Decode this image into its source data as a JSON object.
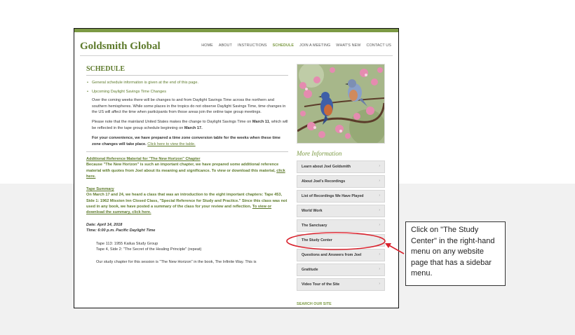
{
  "site": {
    "logo": "Goldsmith Global"
  },
  "nav": [
    "HOME",
    "ABOUT",
    "INSTRUCTIONS",
    "SCHEDULE",
    "JOIN A MEETING",
    "WHAT'S NEW",
    "CONTACT US"
  ],
  "nav_active": "SCHEDULE",
  "main": {
    "title": "SCHEDULE",
    "bullet1": "General schedule information is given at the end of this page.",
    "bullet2": "Upcoming Daylight Savings Time Changes",
    "p1": "Over the coming weeks there will be changes to and from Daylight Savings Time across the northern and southern hemispheres.  While some places in the tropics do not observe Daylight Savings Time, time changes in the US will affect the time when participants from those areas join the online tape group meetings.",
    "p2_a": "Please note that the mainland United States makes the change to Daylight Savings Time on ",
    "p2_b": "March 11",
    "p2_c": ", which will be reflected in the tape group schedule beginning on ",
    "p2_d": "March 17.",
    "p3_a": "For your convenience, we have prepared a time zone conversion table for the weeks when these time zone changes will take place.  ",
    "p3_link": "Click here to view the table.",
    "ref_heading": "Additional Reference Material for \"The New Horizon\" Chapter",
    "ref_text": "Because \"The New Horizon\" is such an important chapter, we have prepared some additional reference material with quotes from Joel about its meaning and significance.  To view or download this material, ",
    "ref_link": "click here.",
    "tape_heading": "Tape Summary",
    "tape_text": "On March 17 and 24, we heard a class that was an introduction to the eight important chapters:  Tape 453, Side 1: 1962 Mission Inn Closed Class, \"Special Reference for Study and Practice.\"  Since this class was not used in any book, we have posted a summary of the class for your review and reflection.  ",
    "tape_link": "To view or download the summary, click here.",
    "date_line": "Date:  April 14, 2018",
    "time_line": "Time:  6:00 p.m. Pacific Daylight Time",
    "tape1": "Tape 113:  1955 Kailua Study Group",
    "tape2": "Tape 4, Side 2:  \"The Secret of the Healing Principle\" (repeat)",
    "cut_line": "Our study chapter for this session is \"The New Horizon\" in the book, The Infinite Way.  This is"
  },
  "sidebar": {
    "heading": "More Information",
    "items": [
      "Learn about Joel Goldsmith",
      "About Joel's Recordings",
      "List of Recordings We Have Played",
      "World Work",
      "The Sanctuary",
      "The Study Center",
      "Questions and Answers from Joel",
      "Gratitude",
      "Video Tour of the Site"
    ],
    "search": "SEARCH OUR SITE"
  },
  "callout": {
    "text": "Click on \"The Study Center\"  in the right-hand menu on any website page that has a sidebar menu."
  },
  "colors": {
    "accent": "#7c9a44",
    "annotation": "#d9232e"
  }
}
